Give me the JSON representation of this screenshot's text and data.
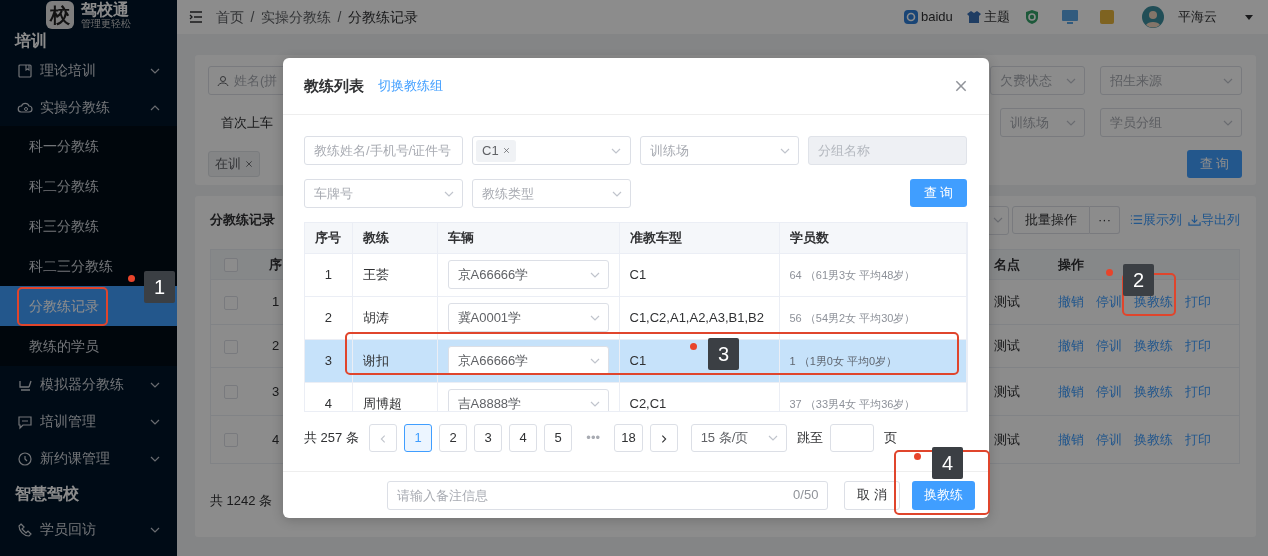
{
  "sidebar": {
    "logo": {
      "mark": "校",
      "name": "驾校通",
      "tagline": "管理更轻松"
    },
    "sections": [
      {
        "title": "培训",
        "items": [
          {
            "label": "理论培训",
            "expanded": false
          },
          {
            "label": "实操分教练",
            "expanded": true,
            "children": [
              {
                "label": "科一分教练",
                "selected": false
              },
              {
                "label": "科二分教练",
                "selected": false
              },
              {
                "label": "科三分教练",
                "selected": false
              },
              {
                "label": "科二三分教练",
                "selected": false
              },
              {
                "label": "分教练记录",
                "selected": true
              },
              {
                "label": "教练的学员",
                "selected": false
              }
            ]
          },
          {
            "label": "模拟器分教练",
            "expanded": false
          },
          {
            "label": "培训管理",
            "expanded": false
          },
          {
            "label": "新约课管理",
            "expanded": false
          }
        ]
      },
      {
        "title": "智慧驾校",
        "items": [
          {
            "label": "学员回访",
            "expanded": false
          }
        ]
      }
    ]
  },
  "header": {
    "breadcrumb": [
      "首页",
      "实操分教练",
      "分教练记录"
    ],
    "separator": "/",
    "links": [
      "baidu",
      "主题"
    ],
    "user": "平海云"
  },
  "filter_panel": {
    "name_placeholder": "姓名(拼",
    "row1_placeholders": [
      "欠费状态",
      "招生来源"
    ],
    "date_label": "首次上车",
    "row2_placeholders": [
      "训练场",
      "学员分组"
    ],
    "tags": [
      "在训"
    ],
    "search_button": "查 询"
  },
  "records_panel": {
    "title": "分教练记录",
    "batch_button": "批量操作",
    "more_button": "···",
    "links": [
      "展示列",
      "导出列"
    ],
    "columns": [
      "序",
      "名点",
      "操作"
    ],
    "header_checked": false,
    "rows": [
      {
        "checked": false,
        "index": "1",
        "column_3": "测试",
        "actions": [
          "撤销",
          "停训",
          "换教练",
          "打印"
        ]
      },
      {
        "checked": false,
        "index": "2",
        "column_3": "测试",
        "actions": [
          "撤销",
          "停训",
          "换教练",
          "打印"
        ]
      },
      {
        "checked": false,
        "index": "3",
        "column_3": "测试",
        "actions": [
          "撤销",
          "停训",
          "换教练",
          "打印"
        ]
      },
      {
        "checked": false,
        "index": "4",
        "column_3": "测试",
        "actions": [
          "撤销",
          "停训",
          "换教练",
          "打印"
        ]
      }
    ],
    "total": "共 1242 条"
  },
  "modal": {
    "title": "教练列表",
    "switch_link": "切换教练组",
    "filters": [
      {
        "kind": "input",
        "placeholder": "教练姓名/手机号/证件号",
        "disabled": false
      },
      {
        "kind": "tags",
        "tags": [
          "C1"
        ],
        "disabled": false
      },
      {
        "kind": "select",
        "placeholder": "训练场",
        "disabled": false
      },
      {
        "kind": "input",
        "placeholder": "分组名称",
        "disabled": true
      },
      {
        "kind": "select",
        "placeholder": "车牌号",
        "disabled": false
      },
      {
        "kind": "select",
        "placeholder": "教练类型",
        "disabled": false
      }
    ],
    "search_button": "查 询",
    "table": {
      "columns": [
        "序号",
        "教练",
        "车辆",
        "准教车型",
        "学员数"
      ],
      "rows": [
        {
          "index": "1",
          "coach": "王荟",
          "vehicle": "京A66666学",
          "license_types": "C1",
          "students": "64 （61男3女 平均48岁）",
          "selected": false
        },
        {
          "index": "2",
          "coach": "胡涛",
          "vehicle": "冀A0001学",
          "license_types": "C1,C2,A1,A2,A3,B1,B2",
          "students": "56 （54男2女 平均30岁）",
          "selected": false
        },
        {
          "index": "3",
          "coach": "谢扣",
          "vehicle": "京A66666学",
          "license_types": "C1",
          "students": "1 （1男0女 平均0岁）",
          "selected": true
        },
        {
          "index": "4",
          "coach": "周博超",
          "vehicle": "吉A8888学",
          "license_types": "C2,C1",
          "students": "37 （33男4女 平均36岁）",
          "selected": false
        }
      ]
    },
    "pagination": {
      "total": "共 257 条",
      "pages": [
        {
          "kind": "page",
          "label": "1",
          "selected": true
        },
        {
          "kind": "page",
          "label": "2",
          "selected": false
        },
        {
          "kind": "page",
          "label": "3",
          "selected": false
        },
        {
          "kind": "page",
          "label": "4",
          "selected": false
        },
        {
          "kind": "page",
          "label": "5",
          "selected": false
        },
        {
          "kind": "ellipsis",
          "label": "•••",
          "selected": false
        },
        {
          "kind": "page",
          "label": "18",
          "selected": false
        }
      ],
      "page_size": "15 条/页",
      "jump_label": "跳至",
      "page_unit": "页"
    },
    "remark": {
      "placeholder": "请输入备注信息",
      "counter": "0/50"
    },
    "cancel_button": "取 消",
    "confirm_button": "换教练"
  },
  "annotations": [
    {
      "label": "1"
    },
    {
      "label": "2"
    },
    {
      "label": "3"
    },
    {
      "label": "4"
    }
  ]
}
